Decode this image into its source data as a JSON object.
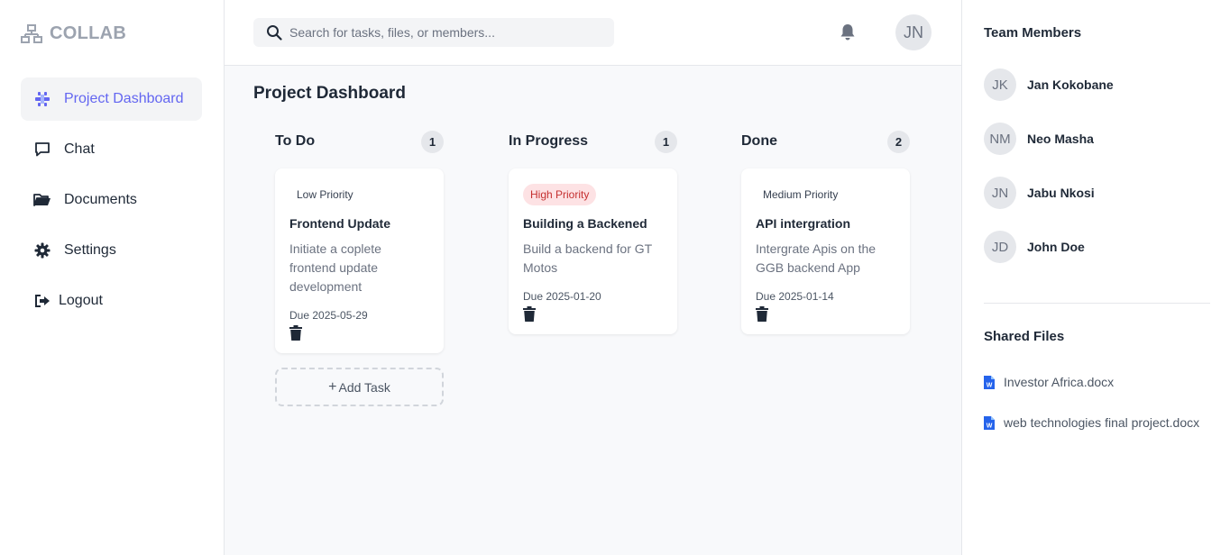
{
  "brand": {
    "name": "COLLAB"
  },
  "sidebar": {
    "items": [
      {
        "label": "Project Dashboard",
        "icon": "dashboard-icon",
        "active": true
      },
      {
        "label": "Chat",
        "icon": "chat-icon"
      },
      {
        "label": "Documents",
        "icon": "folder-icon"
      },
      {
        "label": "Settings",
        "icon": "gear-icon"
      },
      {
        "label": "Logout",
        "icon": "logout-icon"
      }
    ]
  },
  "topbar": {
    "search_placeholder": "Search for tasks, files, or members...",
    "avatar_initials": "JN"
  },
  "main": {
    "title": "Project Dashboard",
    "columns": [
      {
        "title": "To Do",
        "count": "1",
        "cards": [
          {
            "priority": "Low Priority",
            "title": "Frontend Update",
            "description": "Initiate a coplete frontend update development",
            "due": "Due 2025-05-29"
          }
        ],
        "add_label": "Add Task"
      },
      {
        "title": "In Progress",
        "count": "1",
        "cards": [
          {
            "priority": "High Priority",
            "title": "Building a Backened",
            "description": "Build a backend for GT Motos",
            "due": "Due 2025-01-20"
          }
        ]
      },
      {
        "title": "Done",
        "count": "2",
        "cards": [
          {
            "priority": "Medium Priority",
            "title": "API intergration",
            "description": "Intergrate Apis on the GGB backend App",
            "due": "Due 2025-01-14"
          }
        ]
      }
    ]
  },
  "right_panel": {
    "members_title": "Team Members",
    "members": [
      {
        "initials": "JK",
        "name": "Jan Kokobane"
      },
      {
        "initials": "NM",
        "name": "Neo Masha"
      },
      {
        "initials": "JN",
        "name": "Jabu Nkosi"
      },
      {
        "initials": "JD",
        "name": "John Doe"
      }
    ],
    "files_title": "Shared Files",
    "files": [
      {
        "name": "Investor Africa.docx"
      },
      {
        "name": "web technologies final project.docx"
      }
    ]
  },
  "colors": {
    "accent": "#6366f1",
    "high_priority_bg": "#fde2e4",
    "high_priority_text": "#c53030",
    "file_icon": "#2563eb"
  }
}
